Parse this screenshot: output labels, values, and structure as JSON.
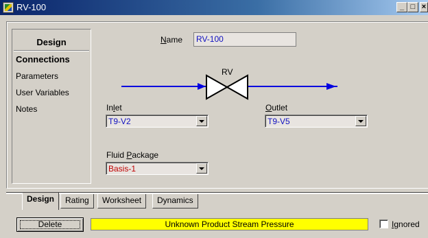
{
  "window": {
    "title": "RV-100",
    "min_glyph": "_",
    "max_glyph": "□",
    "close_glyph": "×"
  },
  "nav": {
    "heading": "Design",
    "items": [
      {
        "label": "Connections",
        "active": true
      },
      {
        "label": "Parameters",
        "active": false
      },
      {
        "label": "User Variables",
        "active": false
      },
      {
        "label": "Notes",
        "active": false
      }
    ]
  },
  "form": {
    "name_label_key": "N",
    "name_label_rest": "ame",
    "name_value": "RV-100",
    "diagram_label": "RV",
    "inlet_label_pre": "In",
    "inlet_label_key": "l",
    "inlet_label_post": "et",
    "inlet_value": "T9-V2",
    "outlet_label_key": "O",
    "outlet_label_rest": "utlet",
    "outlet_value": "T9-V5",
    "fluid_label_pre": "Fluid ",
    "fluid_label_key": "P",
    "fluid_label_post": "ackage",
    "fluid_value": "Basis-1"
  },
  "tabs": [
    {
      "label": "Design",
      "active": true
    },
    {
      "label": "Rating",
      "active": false
    },
    {
      "label": "Worksheet",
      "active": false
    },
    {
      "label": "Dynamics",
      "active": false
    }
  ],
  "footer": {
    "delete_label": "Delete",
    "status_text": "Unknown Product Stream Pressure",
    "ignored_key": "I",
    "ignored_rest": "gnored",
    "ignored_checked": false
  },
  "colors": {
    "stream_line": "#0000e0",
    "status_bg": "#ffff00",
    "field_text": "#1010c0",
    "package_text": "#c00000"
  }
}
